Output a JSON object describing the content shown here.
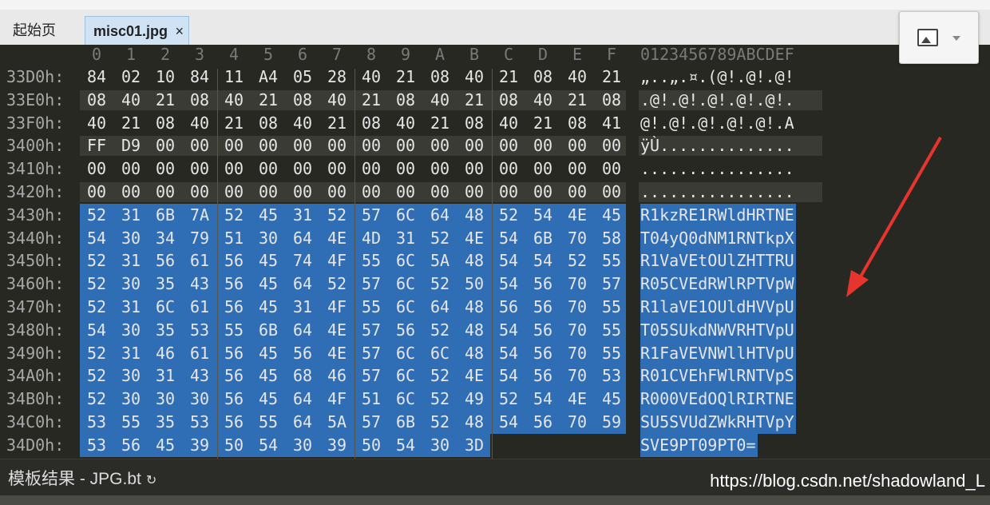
{
  "tabs": [
    {
      "label": "起始页"
    },
    {
      "label": "misc01.jpg",
      "close": "×"
    }
  ],
  "columns": [
    "0",
    "1",
    "2",
    "3",
    "4",
    "5",
    "6",
    "7",
    "8",
    "9",
    "A",
    "B",
    "C",
    "D",
    "E",
    "F"
  ],
  "ascii_header": "0123456789ABCDEF",
  "rows": [
    {
      "addr": "33D0h:",
      "bytes": [
        "84",
        "02",
        "10",
        "84",
        "11",
        "A4",
        "05",
        "28",
        "40",
        "21",
        "08",
        "40",
        "21",
        "08",
        "40",
        "21"
      ],
      "ascii": "„..„.¤.(@!.@!.@!",
      "sel": 0
    },
    {
      "addr": "33E0h:",
      "bytes": [
        "08",
        "40",
        "21",
        "08",
        "40",
        "21",
        "08",
        "40",
        "21",
        "08",
        "40",
        "21",
        "08",
        "40",
        "21",
        "08"
      ],
      "ascii": ".@!.@!.@!.@!.@!.",
      "sel": 0
    },
    {
      "addr": "33F0h:",
      "bytes": [
        "40",
        "21",
        "08",
        "40",
        "21",
        "08",
        "40",
        "21",
        "08",
        "40",
        "21",
        "08",
        "40",
        "21",
        "08",
        "41"
      ],
      "ascii": "@!.@!.@!.@!.@!.A",
      "sel": 0
    },
    {
      "addr": "3400h:",
      "bytes": [
        "FF",
        "D9",
        "00",
        "00",
        "00",
        "00",
        "00",
        "00",
        "00",
        "00",
        "00",
        "00",
        "00",
        "00",
        "00",
        "00"
      ],
      "ascii": "ÿÙ..............",
      "sel": 0
    },
    {
      "addr": "3410h:",
      "bytes": [
        "00",
        "00",
        "00",
        "00",
        "00",
        "00",
        "00",
        "00",
        "00",
        "00",
        "00",
        "00",
        "00",
        "00",
        "00",
        "00"
      ],
      "ascii": "................",
      "sel": 0
    },
    {
      "addr": "3420h:",
      "bytes": [
        "00",
        "00",
        "00",
        "00",
        "00",
        "00",
        "00",
        "00",
        "00",
        "00",
        "00",
        "00",
        "00",
        "00",
        "00",
        "00"
      ],
      "ascii": "................",
      "sel": 0
    },
    {
      "addr": "3430h:",
      "bytes": [
        "52",
        "31",
        "6B",
        "7A",
        "52",
        "45",
        "31",
        "52",
        "57",
        "6C",
        "64",
        "48",
        "52",
        "54",
        "4E",
        "45"
      ],
      "ascii": "R1kzRE1RWldHRTNE",
      "sel": 16
    },
    {
      "addr": "3440h:",
      "bytes": [
        "54",
        "30",
        "34",
        "79",
        "51",
        "30",
        "64",
        "4E",
        "4D",
        "31",
        "52",
        "4E",
        "54",
        "6B",
        "70",
        "58"
      ],
      "ascii": "T04yQ0dNM1RNTkpX",
      "sel": 16
    },
    {
      "addr": "3450h:",
      "bytes": [
        "52",
        "31",
        "56",
        "61",
        "56",
        "45",
        "74",
        "4F",
        "55",
        "6C",
        "5A",
        "48",
        "54",
        "54",
        "52",
        "55"
      ],
      "ascii": "R1VaVEtOUlZHTTRU",
      "sel": 16
    },
    {
      "addr": "3460h:",
      "bytes": [
        "52",
        "30",
        "35",
        "43",
        "56",
        "45",
        "64",
        "52",
        "57",
        "6C",
        "52",
        "50",
        "54",
        "56",
        "70",
        "57"
      ],
      "ascii": "R05CVEdRWlRPTVpW",
      "sel": 16
    },
    {
      "addr": "3470h:",
      "bytes": [
        "52",
        "31",
        "6C",
        "61",
        "56",
        "45",
        "31",
        "4F",
        "55",
        "6C",
        "64",
        "48",
        "56",
        "56",
        "70",
        "55"
      ],
      "ascii": "R1laVE1OUldHVVpU",
      "sel": 16
    },
    {
      "addr": "3480h:",
      "bytes": [
        "54",
        "30",
        "35",
        "53",
        "55",
        "6B",
        "64",
        "4E",
        "57",
        "56",
        "52",
        "48",
        "54",
        "56",
        "70",
        "55"
      ],
      "ascii": "T05SUkdNWVRHTVpU",
      "sel": 16
    },
    {
      "addr": "3490h:",
      "bytes": [
        "52",
        "31",
        "46",
        "61",
        "56",
        "45",
        "56",
        "4E",
        "57",
        "6C",
        "6C",
        "48",
        "54",
        "56",
        "70",
        "55"
      ],
      "ascii": "R1FaVEVNWllHTVpU",
      "sel": 16
    },
    {
      "addr": "34A0h:",
      "bytes": [
        "52",
        "30",
        "31",
        "43",
        "56",
        "45",
        "68",
        "46",
        "57",
        "6C",
        "52",
        "4E",
        "54",
        "56",
        "70",
        "53"
      ],
      "ascii": "R01CVEhFWlRNTVpS",
      "sel": 16
    },
    {
      "addr": "34B0h:",
      "bytes": [
        "52",
        "30",
        "30",
        "30",
        "56",
        "45",
        "64",
        "4F",
        "51",
        "6C",
        "52",
        "49",
        "52",
        "54",
        "4E",
        "45"
      ],
      "ascii": "R000VEdOQlRIRTNE",
      "sel": 16
    },
    {
      "addr": "34C0h:",
      "bytes": [
        "53",
        "55",
        "35",
        "53",
        "56",
        "55",
        "64",
        "5A",
        "57",
        "6B",
        "52",
        "48",
        "54",
        "56",
        "70",
        "59"
      ],
      "ascii": "SU5SVUdZWkRHTVpY",
      "sel": 16
    },
    {
      "addr": "34D0h:",
      "bytes": [
        "53",
        "56",
        "45",
        "39",
        "50",
        "54",
        "30",
        "39",
        "50",
        "54",
        "30",
        "3D"
      ],
      "ascii": "SVE9PT09PT0=",
      "sel": 12
    }
  ],
  "status": {
    "template_label": "模板结果 - JPG.bt",
    "refresh_icon": "↻"
  },
  "watermark": "https://blog.csdn.net/shadowland_L",
  "colors": {
    "selection": "#2f6db5",
    "editor_bg": "#272822",
    "alt_row": "#3a3b35",
    "arrow": "#e8342f"
  }
}
